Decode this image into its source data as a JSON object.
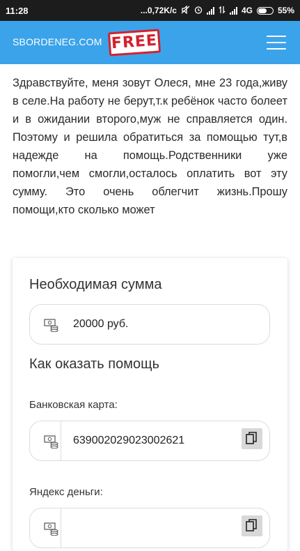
{
  "status_bar": {
    "time": "11:28",
    "speed": "...0,72K/c",
    "network": "4G",
    "battery": "55%"
  },
  "nav": {
    "brand": "SBORDENEG.COM",
    "stamp": "FREE",
    "icons": [
      "menu-icon"
    ]
  },
  "appeal": {
    "text": "Здравствуйте, меня зовут Олеся, мне 23 года,живу в селе.На работу не берут,т.к ребёнок часто болеет и в ожидании второго,муж не справляется один. Поэтому и решила обратиться за помощью тут,в надежде на помощь.Родственники уже помогли,чем смогли,осталось оплатить вот эту сумму. Это очень облегчит жизнь.Прошу помощи,кто сколько может"
  },
  "donation": {
    "amount_heading": "Необходимая сумма",
    "amount_value": "20000 руб.",
    "help_heading": "Как оказать помощь",
    "bank_card_label": "Банковская карта:",
    "bank_card_number": "639002029023002621",
    "yandex_label": "Яндекс деньги:",
    "yandex_value": ""
  },
  "colors": {
    "nav_bg": "#3ba3ea",
    "stamp": "#d2222e",
    "status_bg": "#1c1c1c"
  }
}
